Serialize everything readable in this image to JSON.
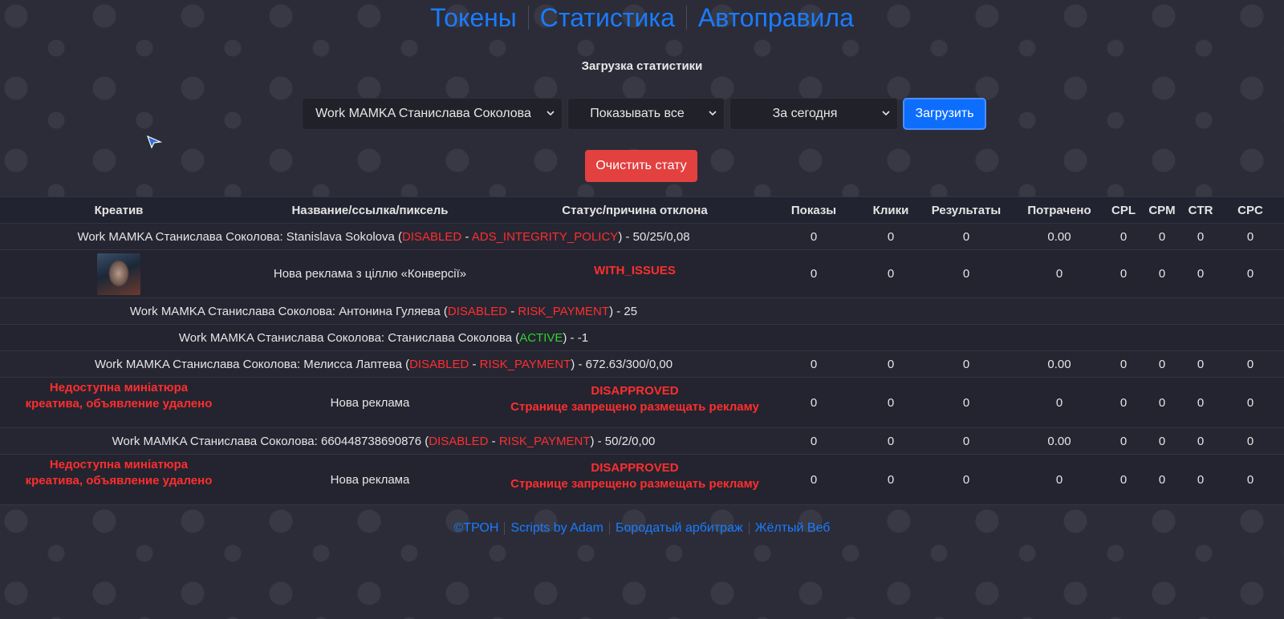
{
  "nav": {
    "tokens": "Токены",
    "statistics": "Статистика",
    "autorules": "Автоправила"
  },
  "section_title": "Загрузка статистики",
  "controls": {
    "account_value": "Work MAMKA Станислава Соколова",
    "filter_value": "Показывать все",
    "period_value": "За сегодня",
    "load_button": "Загрузить",
    "clear_button": "Очистить стату"
  },
  "table": {
    "headers": {
      "creative": "Креатив",
      "name": "Название/ссылка/пиксель",
      "status": "Статус/причина отклона",
      "impressions": "Показы",
      "clicks": "Клики",
      "results": "Результаты",
      "spent": "Потрачено",
      "cpl": "CPL",
      "cpm": "CPM",
      "ctr": "CTR",
      "cpc": "CPC"
    },
    "rows": {
      "r1": {
        "prefix": "Work MAMKA Станислава Соколова: Stanislava Sokolova (",
        "state": "DISABLED",
        "dash": " - ",
        "reason": "ADS_INTEGRITY_POLICY",
        "suffix": ") - 50/25/0,08",
        "impressions": "0",
        "clicks": "0",
        "results": "0",
        "spent": "0.00",
        "cpl": "0",
        "cpm": "0",
        "ctr": "0",
        "cpc": "0"
      },
      "r2": {
        "name": "Нова реклама з ціллю «Конверсії»",
        "status": "WITH_ISSUES",
        "impressions": "0",
        "clicks": "0",
        "results": "0",
        "spent": "0",
        "cpl": "0",
        "cpm": "0",
        "ctr": "0",
        "cpc": "0"
      },
      "r3": {
        "prefix": "Work MAMKA Станислава Соколова: Антонина Гуляева (",
        "state": "DISABLED",
        "dash": " - ",
        "reason": "RISK_PAYMENT",
        "suffix": ") - 25"
      },
      "r4": {
        "prefix": "Work MAMKA Станислава Соколова: Станислава Соколова (",
        "state": "ACTIVE",
        "suffix": ") - -1"
      },
      "r5": {
        "prefix": "Work MAMKA Станислава Соколова: Мелисса Лаптева (",
        "state": "DISABLED",
        "dash": " - ",
        "reason": "RISK_PAYMENT",
        "suffix": ") - 672.63/300/0,00",
        "impressions": "0",
        "clicks": "0",
        "results": "0",
        "spent": "0.00",
        "cpl": "0",
        "cpm": "0",
        "ctr": "0",
        "cpc": "0"
      },
      "r6": {
        "creative_line1": "Недоступна миніатюра",
        "creative_line2": "креатива, объявление удалено",
        "name": "Нова реклама",
        "status_line1": "DISAPPROVED",
        "status_line2": "Странице запрещено размещать рекламу",
        "impressions": "0",
        "clicks": "0",
        "results": "0",
        "spent": "0",
        "cpl": "0",
        "cpm": "0",
        "ctr": "0",
        "cpc": "0"
      },
      "r7": {
        "prefix": "Work MAMKA Станислава Соколова: 660448738690876 (",
        "state": "DISABLED",
        "dash": " - ",
        "reason": "RISK_PAYMENT",
        "suffix": ") - 50/2/0,00",
        "impressions": "0",
        "clicks": "0",
        "results": "0",
        "spent": "0.00",
        "cpl": "0",
        "cpm": "0",
        "ctr": "0",
        "cpc": "0"
      },
      "r8": {
        "creative_line1": "Недоступна миніатюра",
        "creative_line2": "креатива, объявление удалено",
        "name": "Нова реклама",
        "status_line1": "DISAPPROVED",
        "status_line2": "Странице запрещено размещать рекламу",
        "impressions": "0",
        "clicks": "0",
        "results": "0",
        "spent": "0",
        "cpl": "0",
        "cpm": "0",
        "ctr": "0",
        "cpc": "0"
      }
    }
  },
  "footer": {
    "link1": "©ТРОН",
    "link2": "Scripts by Adam",
    "link3": "Бородатый арбитраж",
    "link4": "Жёлтый Веб"
  },
  "colors": {
    "background": "#2b2c38",
    "link_blue": "#1a7cff",
    "primary_button": "#0d6efd",
    "danger_button": "#e34040",
    "status_red": "#ff2e2e",
    "status_green": "#2fd12f"
  },
  "icons": [
    "chevron-down-icon",
    "cursor-arrow-icon",
    "ad-thumbnail"
  ]
}
